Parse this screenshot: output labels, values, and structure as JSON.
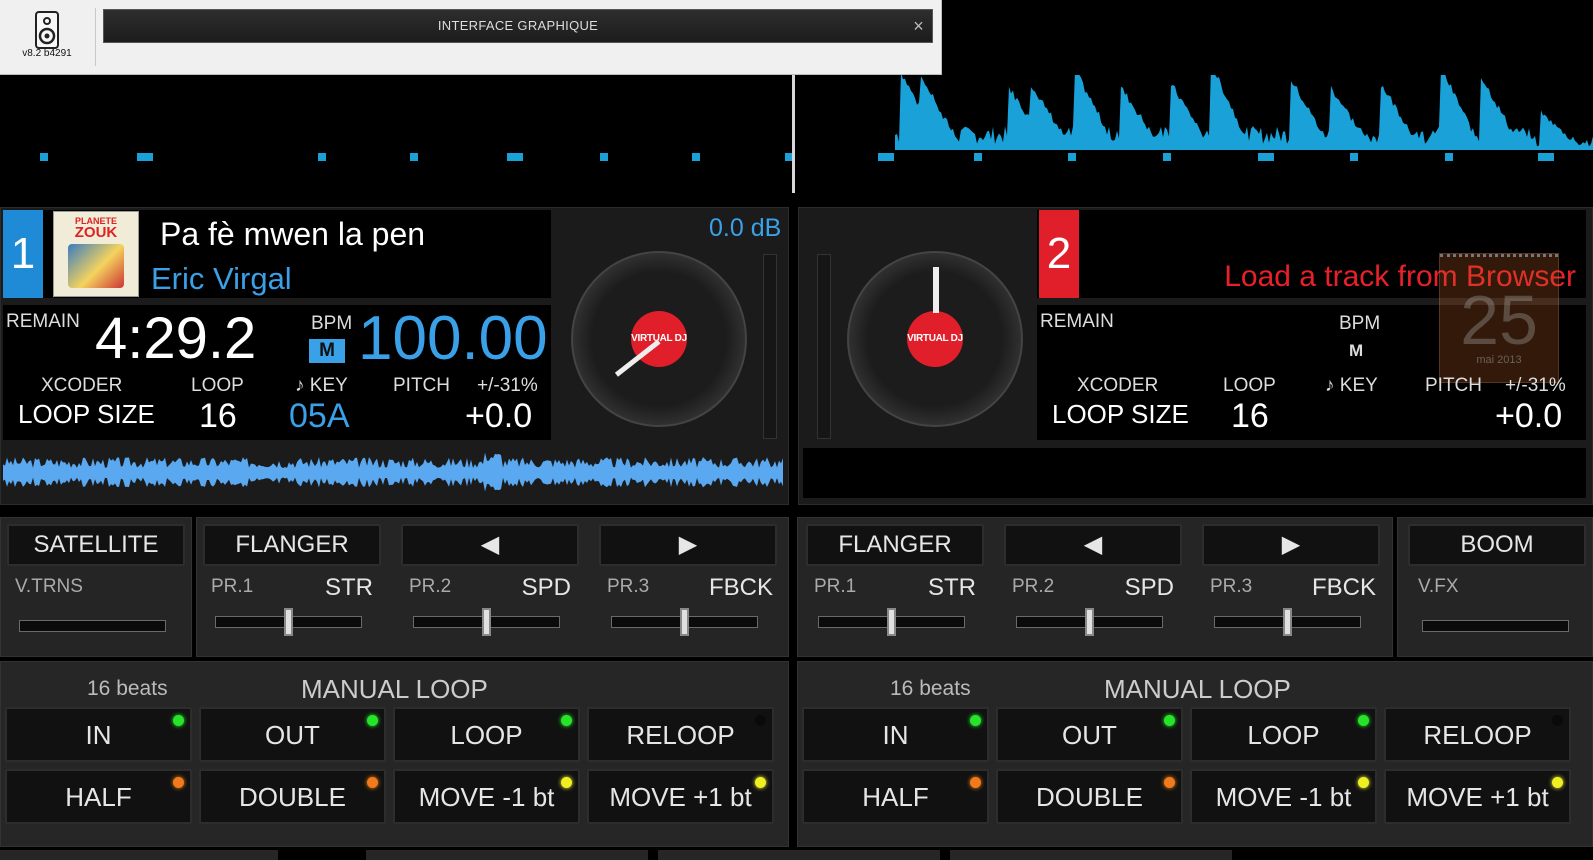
{
  "app": {
    "version": "v8.2 b4291",
    "window_title": "INTERFACE GRAPHIQUE",
    "close_glyph": "×"
  },
  "deck1": {
    "number": "1",
    "title": "Pa fè mwen la pen",
    "artist": "Eric Virgal",
    "gain": "0.0 dB",
    "remain_label": "REMAIN",
    "remain_value": "4:29.2",
    "bpm_label": "BPM",
    "bpm_value": "100.00",
    "m_badge": "M",
    "xcoder_label": "XCODER",
    "loopsize_label": "LOOP SIZE",
    "loop_label": "LOOP",
    "loop_value": "16",
    "key_label": "♪ KEY",
    "key_value": "05A",
    "pitch_label": "PITCH",
    "pitch_range": "+/-31%",
    "pitch_value": "+0.0",
    "cover_text_1": "PLANETE",
    "cover_text_2": "ZOUK",
    "logo_text": "VIRTUAL DJ"
  },
  "deck2": {
    "number": "2",
    "load_msg": "Load a track from Browser",
    "remain_label": "REMAIN",
    "bpm_label": "BPM",
    "m_label": "M",
    "xcoder_label": "XCODER",
    "loopsize_label": "LOOP SIZE",
    "loop_label": "LOOP",
    "loop_value": "16",
    "key_label": "♪ KEY",
    "pitch_label": "PITCH",
    "pitch_range": "+/-31%",
    "pitch_value": "+0.0",
    "calendar_day": "25",
    "calendar_month": "mai 2013",
    "logo_text": "VIRTUAL DJ"
  },
  "fx_left": {
    "effect_button": "SATELLITE",
    "effect_param": "V.TRNS",
    "main_effect": "FLANGER",
    "prev_glyph": "◀",
    "next_glyph": "▶",
    "params": [
      {
        "id": "PR.1",
        "name": "STR",
        "level": 0.5
      },
      {
        "id": "PR.2",
        "name": "SPD",
        "level": 0.5
      },
      {
        "id": "PR.3",
        "name": "FBCK",
        "level": 0.5
      }
    ]
  },
  "fx_right": {
    "effect_button": "BOOM",
    "effect_param": "V.FX",
    "main_effect": "FLANGER",
    "prev_glyph": "◀",
    "next_glyph": "▶",
    "params": [
      {
        "id": "PR.1",
        "name": "STR",
        "level": 0.5
      },
      {
        "id": "PR.2",
        "name": "SPD",
        "level": 0.5
      },
      {
        "id": "PR.3",
        "name": "FBCK",
        "level": 0.5
      }
    ]
  },
  "loop_left": {
    "beats": "16 beats",
    "title": "MANUAL LOOP",
    "row1": [
      "IN",
      "OUT",
      "LOOP",
      "RELOOP"
    ],
    "row2": [
      "HALF",
      "DOUBLE",
      "MOVE -1 bt",
      "MOVE +1 bt"
    ]
  },
  "loop_right": {
    "beats": "16 beats",
    "title": "MANUAL LOOP",
    "row1": [
      "IN",
      "OUT",
      "LOOP",
      "RELOOP"
    ],
    "row2": [
      "HALF",
      "DOUBLE",
      "MOVE -1 bt",
      "MOVE +1 bt"
    ]
  },
  "colors": {
    "accent_blue": "#3aa0e8",
    "deck1_badge": "#1f8ad6",
    "deck2_badge": "#e01f2a",
    "waveform_blue": "#1aa2d8",
    "load_red": "#e8202a"
  }
}
